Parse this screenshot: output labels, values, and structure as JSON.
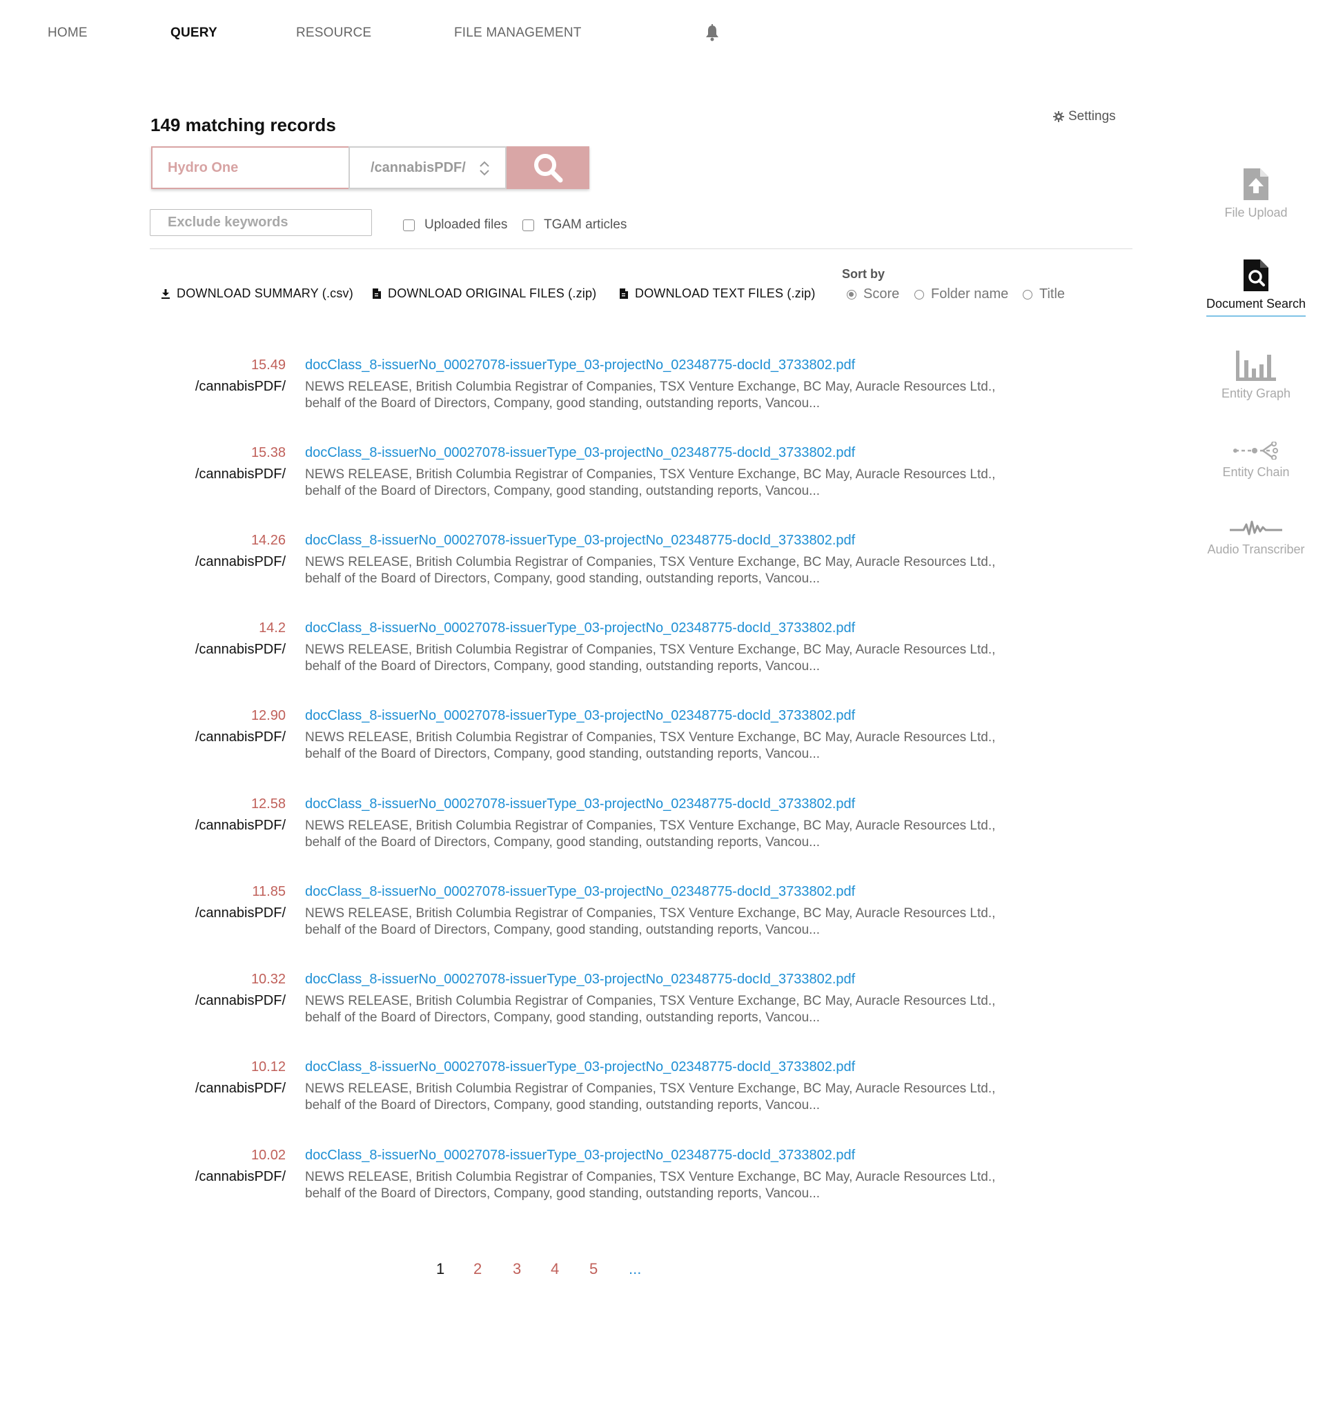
{
  "nav": {
    "items": [
      {
        "label": "HOME"
      },
      {
        "label": "QUERY"
      },
      {
        "label": "RESOURCE"
      },
      {
        "label": "FILE MANAGEMENT"
      }
    ],
    "active": "QUERY",
    "bell_icon": "bell-icon"
  },
  "header": {
    "records": "149 matching records",
    "settings_label": "Settings"
  },
  "search": {
    "query_placeholder": "Hydro One",
    "folder_value": "/cannabisPDF/",
    "exclude_placeholder": "Exclude keywords",
    "accent_color": "#d9a6a6"
  },
  "filters": {
    "uploaded_files": "Uploaded files",
    "tgam_articles": "TGAM articles"
  },
  "downloads": {
    "summary": "DOWNLOAD SUMMARY (.csv)",
    "original": "DOWNLOAD ORIGINAL FILES (.zip)",
    "text": "DOWNLOAD TEXT FILES (.zip)"
  },
  "sort": {
    "label": "Sort by",
    "options": [
      "Score",
      "Folder name",
      "Title"
    ],
    "selected": "Score"
  },
  "results": [
    {
      "score": "15.49",
      "folder": "/cannabisPDF/",
      "title": "docClass_8-issuerNo_00027078-issuerType_03-projectNo_02348775-docId_3733802.pdf",
      "snippet_1": "NEWS RELEASE, British Columbia Registrar of Companies, TSX Venture Exchange, BC May, Auracle Resources Ltd.,",
      "snippet_2": "behalf of the Board of Directors, Company, good standing, outstanding reports, Vancou..."
    },
    {
      "score": "15.38",
      "folder": "/cannabisPDF/",
      "title": "docClass_8-issuerNo_00027078-issuerType_03-projectNo_02348775-docId_3733802.pdf",
      "snippet_1": "NEWS RELEASE, British Columbia Registrar of Companies, TSX Venture Exchange, BC May, Auracle Resources Ltd.,",
      "snippet_2": "behalf of the Board of Directors, Company, good standing, outstanding reports, Vancou..."
    },
    {
      "score": "14.26",
      "folder": "/cannabisPDF/",
      "title": "docClass_8-issuerNo_00027078-issuerType_03-projectNo_02348775-docId_3733802.pdf",
      "snippet_1": "NEWS RELEASE, British Columbia Registrar of Companies, TSX Venture Exchange, BC May, Auracle Resources Ltd.,",
      "snippet_2": "behalf of the Board of Directors, Company, good standing, outstanding reports, Vancou..."
    },
    {
      "score": "14.2",
      "folder": "/cannabisPDF/",
      "title": "docClass_8-issuerNo_00027078-issuerType_03-projectNo_02348775-docId_3733802.pdf",
      "snippet_1": "NEWS RELEASE, British Columbia Registrar of Companies, TSX Venture Exchange, BC May, Auracle Resources Ltd.,",
      "snippet_2": "behalf of the Board of Directors, Company, good standing, outstanding reports, Vancou..."
    },
    {
      "score": "12.90",
      "folder": "/cannabisPDF/",
      "title": "docClass_8-issuerNo_00027078-issuerType_03-projectNo_02348775-docId_3733802.pdf",
      "snippet_1": "NEWS RELEASE, British Columbia Registrar of Companies, TSX Venture Exchange, BC May, Auracle Resources Ltd.,",
      "snippet_2": "behalf of the Board of Directors, Company, good standing, outstanding reports, Vancou..."
    },
    {
      "score": "12.58",
      "folder": "/cannabisPDF/",
      "title": "docClass_8-issuerNo_00027078-issuerType_03-projectNo_02348775-docId_3733802.pdf",
      "snippet_1": "NEWS RELEASE, British Columbia Registrar of Companies, TSX Venture Exchange, BC May, Auracle Resources Ltd.,",
      "snippet_2": "behalf of the Board of Directors, Company, good standing, outstanding reports, Vancou..."
    },
    {
      "score": "11.85",
      "folder": "/cannabisPDF/",
      "title": "docClass_8-issuerNo_00027078-issuerType_03-projectNo_02348775-docId_3733802.pdf",
      "snippet_1": "NEWS RELEASE, British Columbia Registrar of Companies, TSX Venture Exchange, BC May, Auracle Resources Ltd.,",
      "snippet_2": "behalf of the Board of Directors, Company, good standing, outstanding reports, Vancou..."
    },
    {
      "score": "10.32",
      "folder": "/cannabisPDF/",
      "title": "docClass_8-issuerNo_00027078-issuerType_03-projectNo_02348775-docId_3733802.pdf",
      "snippet_1": "NEWS RELEASE, British Columbia Registrar of Companies, TSX Venture Exchange, BC May, Auracle Resources Ltd.,",
      "snippet_2": "behalf of the Board of Directors, Company, good standing, outstanding reports, Vancou..."
    },
    {
      "score": "10.12",
      "folder": "/cannabisPDF/",
      "title": "docClass_8-issuerNo_00027078-issuerType_03-projectNo_02348775-docId_3733802.pdf",
      "snippet_1": "NEWS RELEASE, British Columbia Registrar of Companies, TSX Venture Exchange, BC May, Auracle Resources Ltd.,",
      "snippet_2": "behalf of the Board of Directors, Company, good standing, outstanding reports, Vancou..."
    },
    {
      "score": "10.02",
      "folder": "/cannabisPDF/",
      "title": "docClass_8-issuerNo_00027078-issuerType_03-projectNo_02348775-docId_3733802.pdf",
      "snippet_1": "NEWS RELEASE, British Columbia Registrar of Companies, TSX Venture Exchange, BC May, Auracle Resources Ltd.,",
      "snippet_2": "behalf of the Board of Directors, Company, good standing, outstanding reports, Vancou..."
    }
  ],
  "pagination": {
    "pages": [
      "1",
      "2",
      "3",
      "4",
      "5"
    ],
    "more": "...",
    "current": "1"
  },
  "tools": [
    {
      "label": "File Upload",
      "icon": "file-upload-icon"
    },
    {
      "label": "Document Search",
      "icon": "document-search-icon",
      "active": true
    },
    {
      "label": "Entity Graph",
      "icon": "entity-graph-icon"
    },
    {
      "label": "Entity Chain",
      "icon": "entity-chain-icon"
    },
    {
      "label": "Audio Transcriber",
      "icon": "audio-transcriber-icon"
    }
  ],
  "colors": {
    "score": "#c0605a",
    "link": "#1e8fd4",
    "tool_active_underline": "#7fc3e6"
  }
}
